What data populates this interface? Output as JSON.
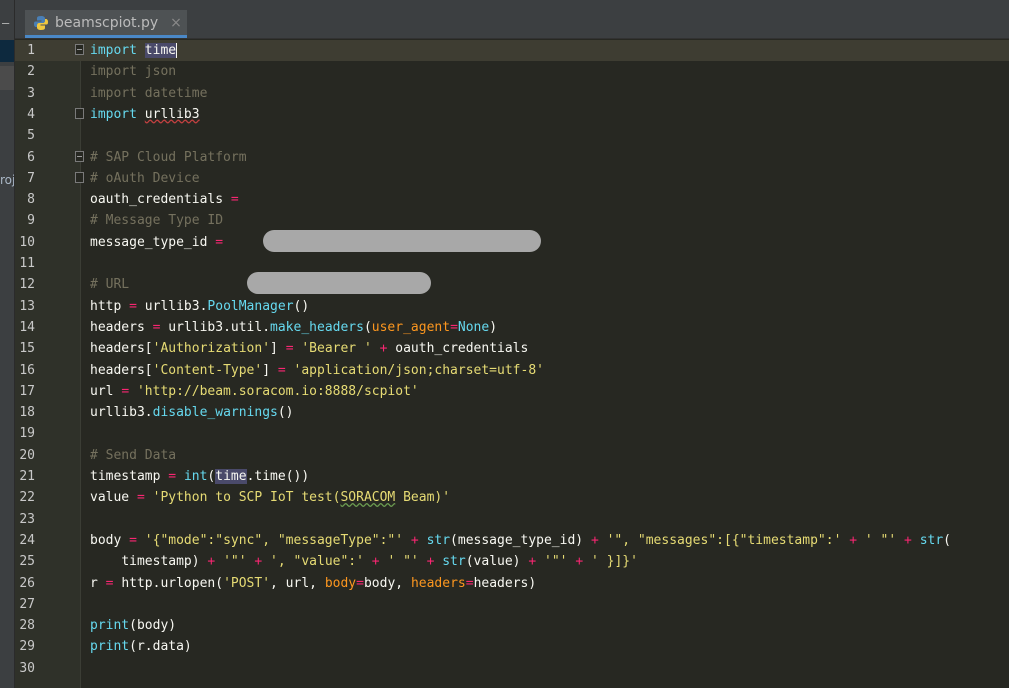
{
  "tab": {
    "filename": "beamscpiot.py",
    "close": "×"
  },
  "sidebar": {
    "label": "roj"
  },
  "line_numbers": [
    "1",
    "2",
    "3",
    "4",
    "5",
    "6",
    "7",
    "8",
    "9",
    "10",
    "11",
    "12",
    "13",
    "14",
    "15",
    "16",
    "17",
    "18",
    "19",
    "20",
    "21",
    "22",
    "23",
    "24",
    "25",
    "26",
    "27",
    "28",
    "29",
    "30"
  ],
  "code": {
    "l1_kw": "import",
    "l1_mod": "time",
    "l2": "import json",
    "l3": "import datetime",
    "l4_kw": "import",
    "l4_mod": "urllib3",
    "l6": "# SAP Cloud Platform",
    "l7": "# oAuth Device",
    "l8": "oauth_credentials",
    "l9": "# Message Type ID",
    "l10": "message_type_id",
    "l12": "# URL",
    "l13_a": "http",
    "l13_b": "urllib3.",
    "l13_c": "PoolManager",
    "l13_d": "()",
    "l14_a": "headers",
    "l14_b": "urllib3.util.",
    "l14_c": "make_headers",
    "l14_d": "(",
    "l14_e": "user_agent",
    "l14_f": "None",
    "l14_g": ")",
    "l15_a": "headers[",
    "l15_b": "'Authorization'",
    "l15_c": "] ",
    "l15_d": "'Bearer '",
    "l15_e": "oauth_credentials",
    "l16_a": "headers[",
    "l16_b": "'Content-Type'",
    "l16_c": "] ",
    "l16_d": "'application/json;charset=utf-8'",
    "l17_a": "url",
    "l17_b": "'http://beam.soracom.io:8888/scpiot'",
    "l18_a": "urllib3.",
    "l18_b": "disable_warnings",
    "l18_c": "()",
    "l20": "# Send Data",
    "l21_a": "timestamp",
    "l21_b": "int",
    "l21_c": "(",
    "l21_d": "time",
    "l21_e": ".time())",
    "l22_a": "value",
    "l22_b": "'Python to SCP IoT test(",
    "l22_c": "SORACOM",
    "l22_d": " Beam)'",
    "l24_a": "body",
    "l24_b": "'{\"mode\":\"sync\", \"messageType\":\"'",
    "l24_c": "str",
    "l24_d": "(message_type_id) ",
    "l24_e": "'\", \"messages\":[{\"timestamp\":'",
    "l24_f": "' \"'",
    "l24_g": "str",
    "l25_a": "timestamp) ",
    "l25_b": "'\"'",
    "l25_c": "', \"value\":'",
    "l25_d": "' \"'",
    "l25_e": "str",
    "l25_f": "(value) ",
    "l25_g": "'\"'",
    "l25_h": "' }]}'",
    "l26_a": "r",
    "l26_b": "http.urlopen(",
    "l26_c": "'POST'",
    "l26_d": ", url, ",
    "l26_e": "body",
    "l26_f": "body, ",
    "l26_g": "headers",
    "l26_h": "headers)",
    "l28_a": "print",
    "l28_b": "(body)",
    "l29_a": "print",
    "l29_b": "(r.data)"
  },
  "colors": {
    "background": "#272822",
    "keyword": "#66d9ef",
    "string": "#e6db74",
    "operator": "#f92672",
    "comment": "#75715e",
    "param": "#fd971f"
  }
}
